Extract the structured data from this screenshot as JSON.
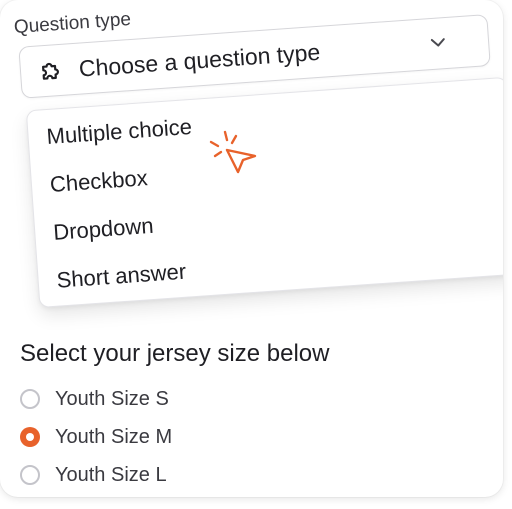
{
  "question_type": {
    "label": "Question type",
    "placeholder": "Choose a question type",
    "icon": "puzzle-icon",
    "options": [
      "Multiple choice",
      "Checkbox",
      "Dropdown",
      "Short answer"
    ]
  },
  "question": {
    "title": "Select your jersey size below",
    "options": [
      {
        "label": "Youth Size S",
        "selected": false
      },
      {
        "label": "Youth Size M",
        "selected": true
      },
      {
        "label": "Youth Size L",
        "selected": false
      }
    ]
  },
  "colors": {
    "accent": "#e8622b",
    "text": "#1f1f24",
    "border": "#d6d6da"
  }
}
